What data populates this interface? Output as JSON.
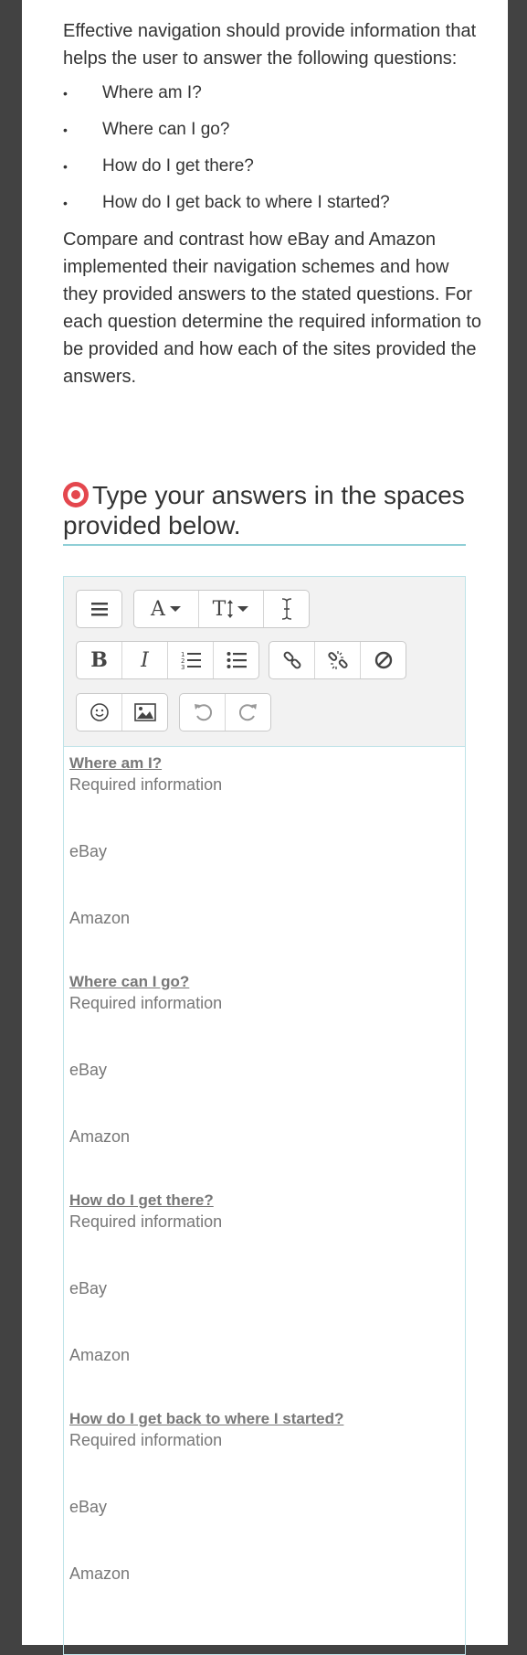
{
  "intro": "Effective navigation should provide information that helps the user to answer the following questions:",
  "questions": [
    "Where am I?",
    "Where can I go?",
    "How do I get there?",
    "How do I get back to where I started?"
  ],
  "bullet": "•",
  "compare": "Compare and contrast how eBay and Amazon implemented their navigation schemes and how they provided answers to the stated questions. For each question determine the required information to be provided and how each of the sites provided the answers.",
  "instruction": "Type your answers in the spaces provided below.",
  "toolbar": {
    "font_label": "A",
    "size_label": "T",
    "bold_label": "B",
    "italic_label": "I"
  },
  "editor": {
    "sections": [
      {
        "heading": "Where am I?",
        "req": "Required information",
        "ebay": "eBay",
        "amazon": "Amazon"
      },
      {
        "heading": "Where can I go?",
        "req": "Required information",
        "ebay": "eBay",
        "amazon": "Amazon"
      },
      {
        "heading": "How do I get there?",
        "req": "Required information",
        "ebay": "eBay",
        "amazon": "Amazon"
      },
      {
        "heading": "How do I get back to where I started?",
        "req": "Required information",
        "ebay": "eBay",
        "amazon": "Amazon"
      }
    ]
  },
  "colors": {
    "background": "#424242",
    "accent_underline": "#8fcfd6",
    "target_icon": "#e4474e"
  }
}
